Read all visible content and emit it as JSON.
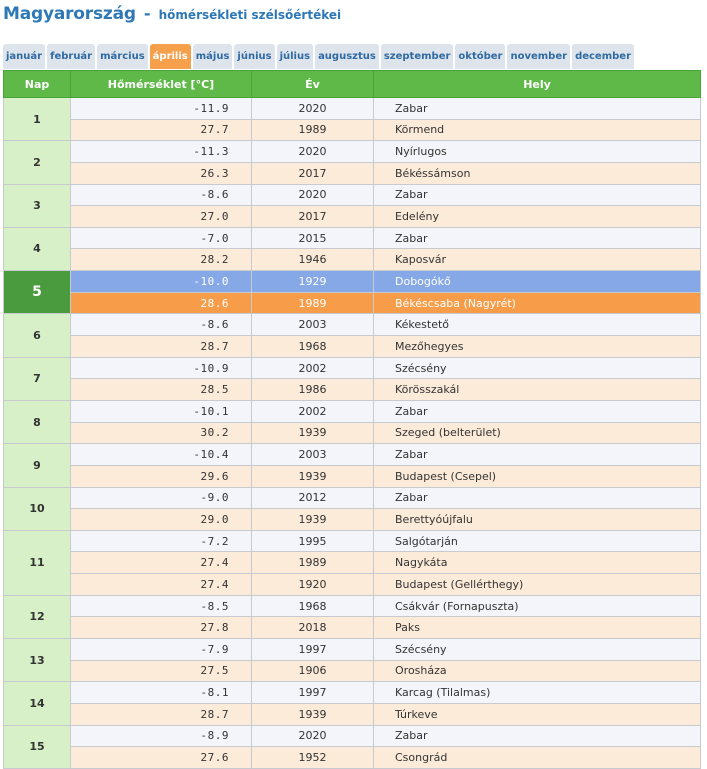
{
  "header": {
    "title": "Magyarország",
    "separator": "-",
    "subtitle": "hőmérsékleti szélsőértékei"
  },
  "tabs": [
    {
      "label": "január",
      "active": false
    },
    {
      "label": "február",
      "active": false
    },
    {
      "label": "március",
      "active": false
    },
    {
      "label": "április",
      "active": true
    },
    {
      "label": "május",
      "active": false
    },
    {
      "label": "június",
      "active": false
    },
    {
      "label": "július",
      "active": false
    },
    {
      "label": "augusztus",
      "active": false
    },
    {
      "label": "szeptember",
      "active": false
    },
    {
      "label": "október",
      "active": false
    },
    {
      "label": "november",
      "active": false
    },
    {
      "label": "december",
      "active": false
    }
  ],
  "table": {
    "headers": [
      "Nap",
      "Hőmérséklet [°C]",
      "Év",
      "Hely"
    ],
    "colors": {
      "header": "#5fb948",
      "min_row": "#f3f5fb",
      "max_row": "#fdebda",
      "min_current": "#86a8e6",
      "max_current": "#f79d4a",
      "day_cell": "#d7f0c7",
      "day_current": "#4a9a3e"
    },
    "days": [
      {
        "day": "1",
        "current": false,
        "records": [
          {
            "type": "min",
            "temp": "-11.9",
            "year": "2020",
            "place": "Zabar"
          },
          {
            "type": "max",
            "temp": "27.7",
            "year": "1989",
            "place": "Körmend"
          }
        ]
      },
      {
        "day": "2",
        "current": false,
        "records": [
          {
            "type": "min",
            "temp": "-11.3",
            "year": "2020",
            "place": "Nyírlugos"
          },
          {
            "type": "max",
            "temp": "26.3",
            "year": "2017",
            "place": "Békéssámson"
          }
        ]
      },
      {
        "day": "3",
        "current": false,
        "records": [
          {
            "type": "min",
            "temp": "-8.6",
            "year": "2020",
            "place": "Zabar"
          },
          {
            "type": "max",
            "temp": "27.0",
            "year": "2017",
            "place": "Edelény"
          }
        ]
      },
      {
        "day": "4",
        "current": false,
        "records": [
          {
            "type": "min",
            "temp": "-7.0",
            "year": "2015",
            "place": "Zabar"
          },
          {
            "type": "max",
            "temp": "28.2",
            "year": "1946",
            "place": "Kaposvár"
          }
        ]
      },
      {
        "day": "5",
        "current": true,
        "records": [
          {
            "type": "min",
            "temp": "-10.0",
            "year": "1929",
            "place": "Dobogókő"
          },
          {
            "type": "max",
            "temp": "28.6",
            "year": "1989",
            "place": "Békéscsaba (Nagyrét)"
          }
        ]
      },
      {
        "day": "6",
        "current": false,
        "records": [
          {
            "type": "min",
            "temp": "-8.6",
            "year": "2003",
            "place": "Kékestető"
          },
          {
            "type": "max",
            "temp": "28.7",
            "year": "1968",
            "place": "Mezőhegyes"
          }
        ]
      },
      {
        "day": "7",
        "current": false,
        "records": [
          {
            "type": "min",
            "temp": "-10.9",
            "year": "2002",
            "place": "Szécsény"
          },
          {
            "type": "max",
            "temp": "28.5",
            "year": "1986",
            "place": "Körösszakál"
          }
        ]
      },
      {
        "day": "8",
        "current": false,
        "records": [
          {
            "type": "min",
            "temp": "-10.1",
            "year": "2002",
            "place": "Zabar"
          },
          {
            "type": "max",
            "temp": "30.2",
            "year": "1939",
            "place": "Szeged (belterület)"
          }
        ]
      },
      {
        "day": "9",
        "current": false,
        "records": [
          {
            "type": "min",
            "temp": "-10.4",
            "year": "2003",
            "place": "Zabar"
          },
          {
            "type": "max",
            "temp": "29.6",
            "year": "1939",
            "place": "Budapest (Csepel)"
          }
        ]
      },
      {
        "day": "10",
        "current": false,
        "records": [
          {
            "type": "min",
            "temp": "-9.0",
            "year": "2012",
            "place": "Zabar"
          },
          {
            "type": "max",
            "temp": "29.0",
            "year": "1939",
            "place": "Berettyóújfalu"
          }
        ]
      },
      {
        "day": "11",
        "current": false,
        "records": [
          {
            "type": "min",
            "temp": "-7.2",
            "year": "1995",
            "place": "Salgótarján"
          },
          {
            "type": "max",
            "temp": "27.4",
            "year": "1989",
            "place": "Nagykáta"
          },
          {
            "type": "max",
            "temp": "27.4",
            "year": "1920",
            "place": "Budapest (Gellérthegy)"
          }
        ]
      },
      {
        "day": "12",
        "current": false,
        "records": [
          {
            "type": "min",
            "temp": "-8.5",
            "year": "1968",
            "place": "Csákvár (Fornapuszta)"
          },
          {
            "type": "max",
            "temp": "27.8",
            "year": "2018",
            "place": "Paks"
          }
        ]
      },
      {
        "day": "13",
        "current": false,
        "records": [
          {
            "type": "min",
            "temp": "-7.9",
            "year": "1997",
            "place": "Szécsény"
          },
          {
            "type": "max",
            "temp": "27.5",
            "year": "1906",
            "place": "Orosháza"
          }
        ]
      },
      {
        "day": "14",
        "current": false,
        "records": [
          {
            "type": "min",
            "temp": "-8.1",
            "year": "1997",
            "place": "Karcag (Tilalmas)"
          },
          {
            "type": "max",
            "temp": "28.7",
            "year": "1939",
            "place": "Túrkeve"
          }
        ]
      },
      {
        "day": "15",
        "current": false,
        "records": [
          {
            "type": "min",
            "temp": "-8.9",
            "year": "2020",
            "place": "Zabar"
          },
          {
            "type": "max",
            "temp": "27.6",
            "year": "1952",
            "place": "Csongrád"
          }
        ]
      }
    ]
  }
}
